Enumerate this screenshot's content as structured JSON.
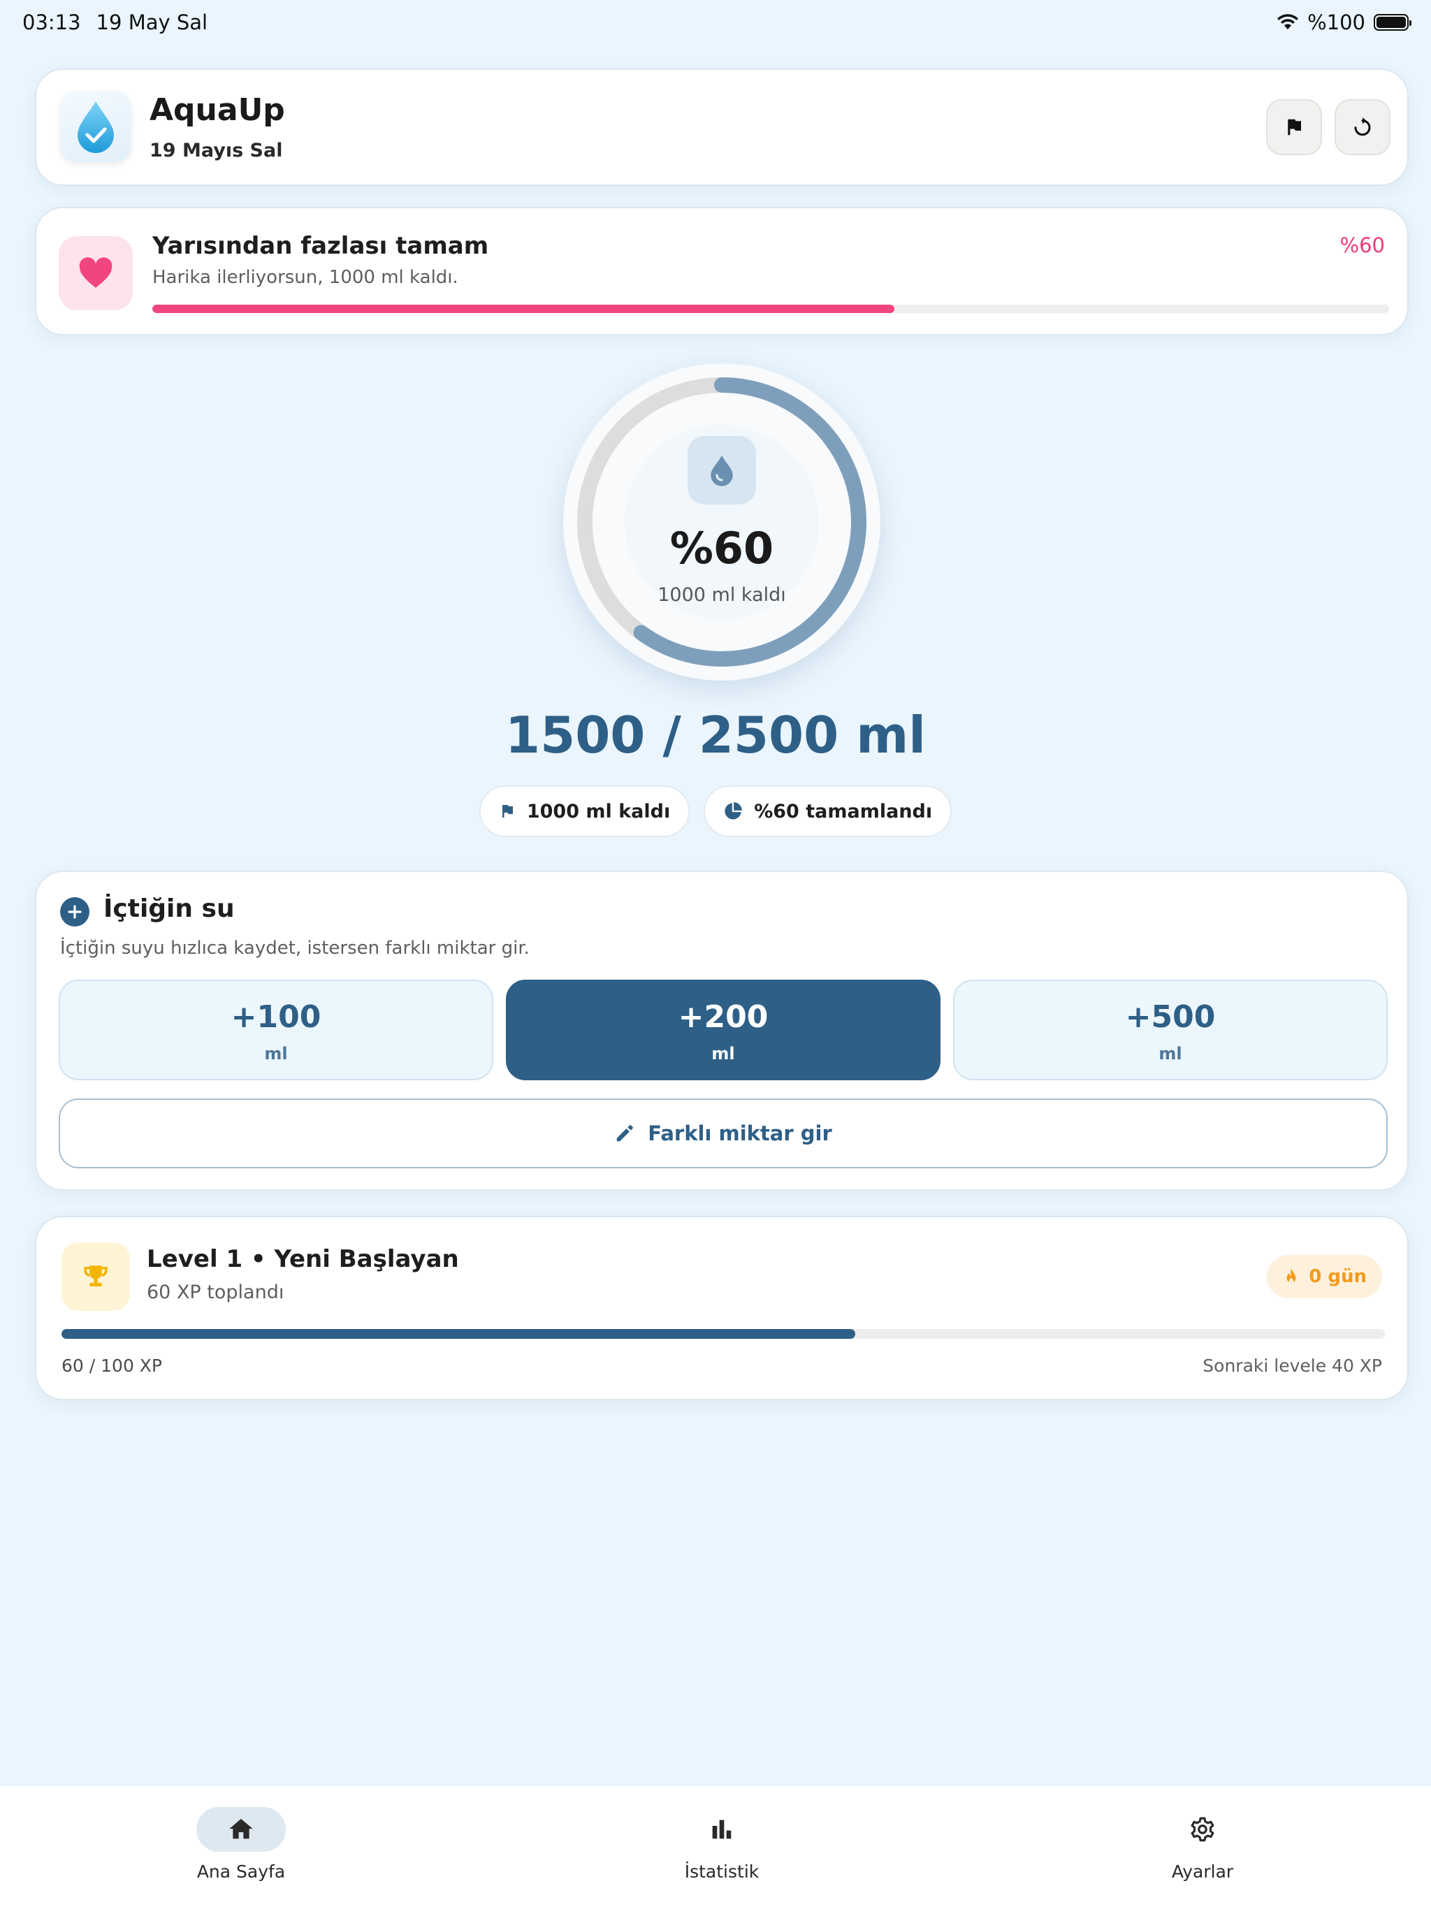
{
  "status_bar": {
    "time": "03:13",
    "date": "19 May Sal",
    "battery": "%100"
  },
  "header": {
    "app_name": "AquaUp",
    "date": "19 Mayıs Sal",
    "icons": [
      "water-drop-icon",
      "flag-icon",
      "reset-icon"
    ]
  },
  "progress_message": {
    "title": "Yarısından fazlası tamam",
    "subtitle": "Harika ilerliyorsun, 1000 ml kaldı.",
    "percent_label": "%60",
    "progress": 0.6,
    "accent": "#F1457E"
  },
  "ring": {
    "percent_label": "%60",
    "remaining_label": "1000 ml kaldı",
    "progress": 0.6
  },
  "summary": {
    "total_label": "1500 / 2500 ml",
    "chip_remaining": "1000 ml kaldı",
    "chip_completed": "%60 tamamlandı"
  },
  "water_entry": {
    "title": "İçtiğin su",
    "subtitle": "İçtiğin suyu hızlıca kaydet, istersen farklı miktar gir.",
    "amounts": [
      {
        "value": "+100",
        "unit": "ml"
      },
      {
        "value": "+200",
        "unit": "ml"
      },
      {
        "value": "+500",
        "unit": "ml"
      }
    ],
    "selected_index": 1,
    "custom_label": "Farklı miktar gir"
  },
  "level": {
    "title": "Level 1 • Yeni Başlayan",
    "subtitle": "60 XP toplandı",
    "streak_label": "0 gün",
    "xp_label": "60 / 100 XP",
    "next_label": "Sonraki levele 40 XP",
    "progress": 0.6
  },
  "nav": {
    "items": [
      {
        "label": "Ana Sayfa",
        "icon": "home-icon"
      },
      {
        "label": "İstatistik",
        "icon": "bar-chart-icon"
      },
      {
        "label": "Ayarlar",
        "icon": "gear-icon"
      }
    ],
    "active_index": 0
  },
  "colors": {
    "primary": "#2E5F87",
    "background": "#EAF5FD",
    "streak": "#F39A1B"
  }
}
